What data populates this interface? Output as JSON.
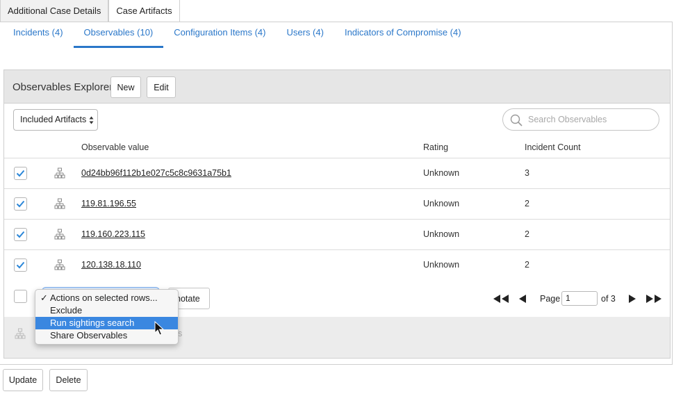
{
  "top_tabs": [
    {
      "label": "Additional Case Details",
      "active": false
    },
    {
      "label": "Case Artifacts",
      "active": true
    }
  ],
  "sub_tabs": [
    {
      "label": "Incidents (4)",
      "active": false
    },
    {
      "label": "Observables (10)",
      "active": true
    },
    {
      "label": "Configuration Items (4)",
      "active": false
    },
    {
      "label": "Users (4)",
      "active": false
    },
    {
      "label": "Indicators of Compromise (4)",
      "active": false
    }
  ],
  "explorer": {
    "title": "Observables Explorer",
    "new_label": "New",
    "edit_label": "Edit",
    "filter_value": "Included Artifacts",
    "search_placeholder": "Search Observables"
  },
  "columns": [
    "Observable value",
    "Rating",
    "Incident Count"
  ],
  "rows": [
    {
      "value": "0d24bb96f112b1e027c5c8c9631a75b1",
      "rating": "Unknown",
      "count": "3",
      "checked": true
    },
    {
      "value": "119.81.196.55",
      "rating": "Unknown",
      "count": "2",
      "checked": true
    },
    {
      "value": "119.160.223.115",
      "rating": "Unknown",
      "count": "2",
      "checked": true
    },
    {
      "value": "120.138.18.110",
      "rating": "Unknown",
      "count": "2",
      "checked": true
    }
  ],
  "footer": {
    "annotate_label": "notate",
    "page_label": "Page",
    "page_value": "1",
    "of_label": "of 3",
    "partial_text": "s"
  },
  "actions_menu": {
    "items": [
      "Actions on selected rows...",
      "Exclude",
      "Run sightings search",
      "Share Observables"
    ],
    "checked_index": 0,
    "highlight_index": 2
  },
  "bottom_buttons": {
    "update_label": "Update",
    "delete_label": "Delete"
  },
  "colors": {
    "accent": "#2a77c9",
    "check": "#2a86d8",
    "highlight": "#3a87e0"
  }
}
